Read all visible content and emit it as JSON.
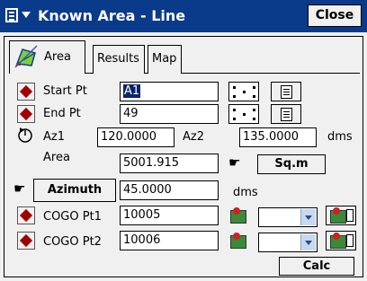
{
  "window": {
    "title": "Known Area - Line",
    "close_label": "Close"
  },
  "tabs": [
    {
      "label": "Area",
      "active": true
    },
    {
      "label": "Results",
      "active": false
    },
    {
      "label": "Map",
      "active": false
    }
  ],
  "form": {
    "start_pt_label": "Start Pt",
    "start_pt_value": "A1",
    "end_pt_label": "End Pt",
    "end_pt_value": "49",
    "az1_label": "Az1",
    "az1_value": "120.0000",
    "az2_label": "Az2",
    "az2_value": "135.0000",
    "az_units": "dms",
    "area_label": "Area",
    "area_value": "5001.915",
    "area_units_button": "Sq.m",
    "azimuth_button": "Azimuth",
    "azimuth_value": "45.0000",
    "azimuth_units": "dms",
    "cogo1_label": "COGO Pt1",
    "cogo1_value": "10005",
    "cogo2_label": "COGO Pt2",
    "cogo2_value": "10006",
    "calc_button": "Calc"
  },
  "icons": {
    "app_menu": "app-menu-icon",
    "tab_area": "area-chart-icon",
    "diamond": "red-diamond-icon",
    "pick": "pick-point-icon",
    "list": "point-list-icon",
    "rotate": "rotate-icon",
    "hand": "pointing-hand-icon",
    "map": "map-icon"
  },
  "colors": {
    "titlebar": "#0a3a8a",
    "accent": "#a00000",
    "selection": "#0a246a"
  }
}
